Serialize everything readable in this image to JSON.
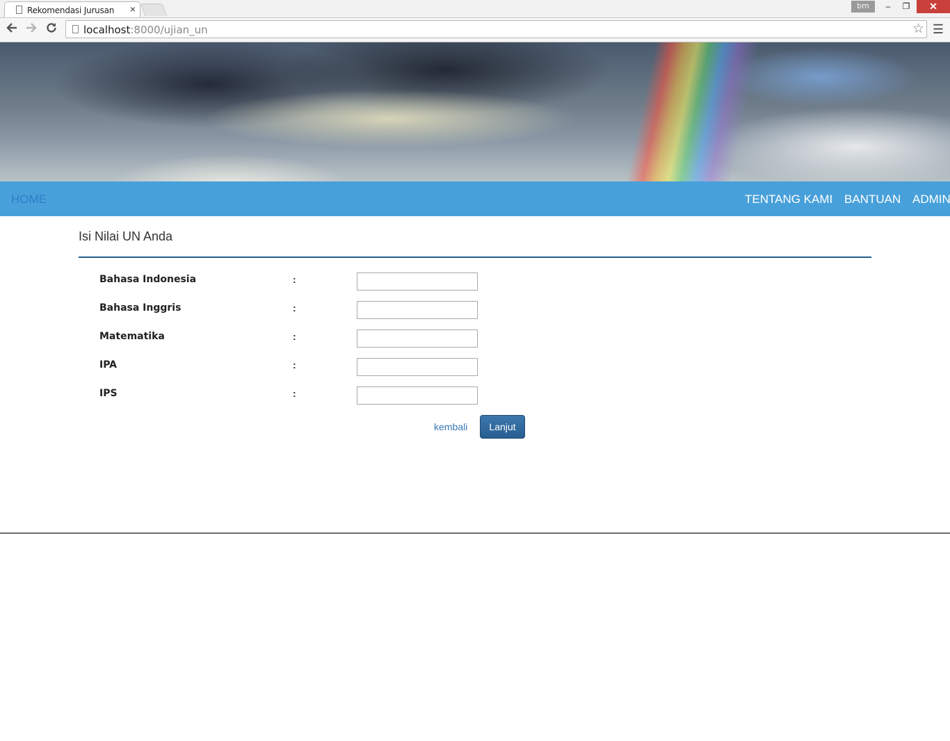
{
  "browser": {
    "tab_title": "Rekomendasi Jurusan",
    "tab_close": "×",
    "profile": "bm",
    "url_host": "localhost",
    "url_rest": ":8000/ujian_un",
    "window_controls": {
      "minimize": "‒",
      "maximize": "❐",
      "close": "✕"
    },
    "icons": {
      "back": "back-arrow-icon",
      "forward": "forward-arrow-icon",
      "reload": "reload-icon",
      "star": "star-icon",
      "menu": "hamburger-menu-icon"
    }
  },
  "nav": {
    "home": "HOME",
    "tentang": "TENTANG KAMI",
    "bantuan": "BANTUAN",
    "admin": "ADMIN"
  },
  "form": {
    "title": "Isi Nilai UN Anda",
    "colon": ":",
    "fields": [
      {
        "label": "Bahasa Indonesia",
        "value": ""
      },
      {
        "label": "Bahasa Inggris",
        "value": ""
      },
      {
        "label": "Matematika",
        "value": ""
      },
      {
        "label": "IPA",
        "value": ""
      },
      {
        "label": "IPS",
        "value": ""
      }
    ],
    "back_label": "kembali",
    "submit_label": "Lanjut"
  },
  "colors": {
    "nav_bar": "#48a0da",
    "accent_rule": "#1f5f8d",
    "button": "#285e91",
    "close_button": "#c9403a"
  }
}
